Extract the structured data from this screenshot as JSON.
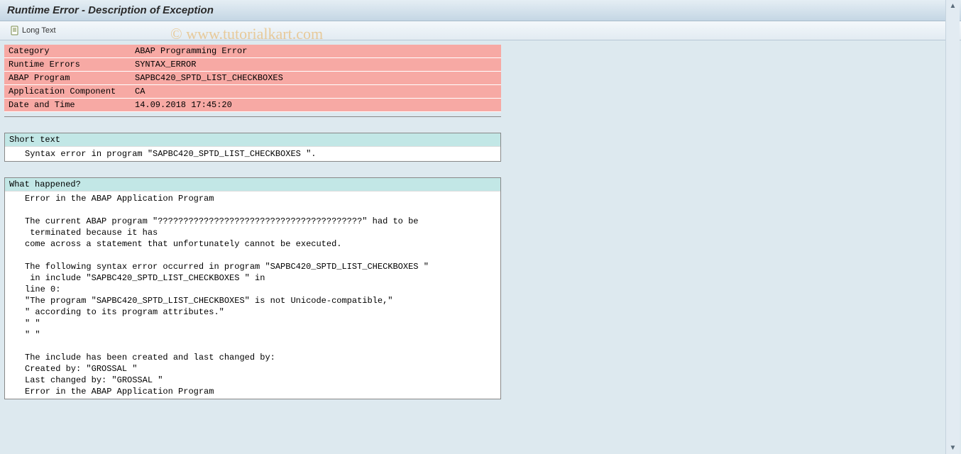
{
  "window": {
    "title": "Runtime Error - Description of Exception"
  },
  "toolbar": {
    "long_text_label": "Long Text"
  },
  "watermark": "© www.tutorialkart.com",
  "info": {
    "rows": [
      {
        "label": "Category",
        "value": "ABAP Programming Error"
      },
      {
        "label": "Runtime Errors",
        "value": "SYNTAX_ERROR"
      },
      {
        "label": "ABAP Program",
        "value": "SAPBC420_SPTD_LIST_CHECKBOXES"
      },
      {
        "label": "Application Component",
        "value": "CA"
      },
      {
        "label": "Date and Time",
        "value": "14.09.2018 17:45:20"
      }
    ]
  },
  "sections": [
    {
      "title": "Short text",
      "lines": [
        "Syntax error in program \"SAPBC420_SPTD_LIST_CHECKBOXES \"."
      ]
    },
    {
      "title": "What happened?",
      "lines": [
        "Error in the ABAP Application Program",
        "",
        "The current ABAP program \"????????????????????????????????????????\" had to be",
        " terminated because it has",
        "come across a statement that unfortunately cannot be executed.",
        "",
        "The following syntax error occurred in program \"SAPBC420_SPTD_LIST_CHECKBOXES \"",
        " in include \"SAPBC420_SPTD_LIST_CHECKBOXES \" in",
        "line 0:",
        "\"The program \"SAPBC420_SPTD_LIST_CHECKBOXES\" is not Unicode-compatible,\"",
        "\" according to its program attributes.\"",
        "\" \"",
        "\" \"",
        "",
        "The include has been created and last changed by:",
        "Created by: \"GROSSAL \"",
        "Last changed by: \"GROSSAL \"",
        "Error in the ABAP Application Program"
      ]
    }
  ]
}
